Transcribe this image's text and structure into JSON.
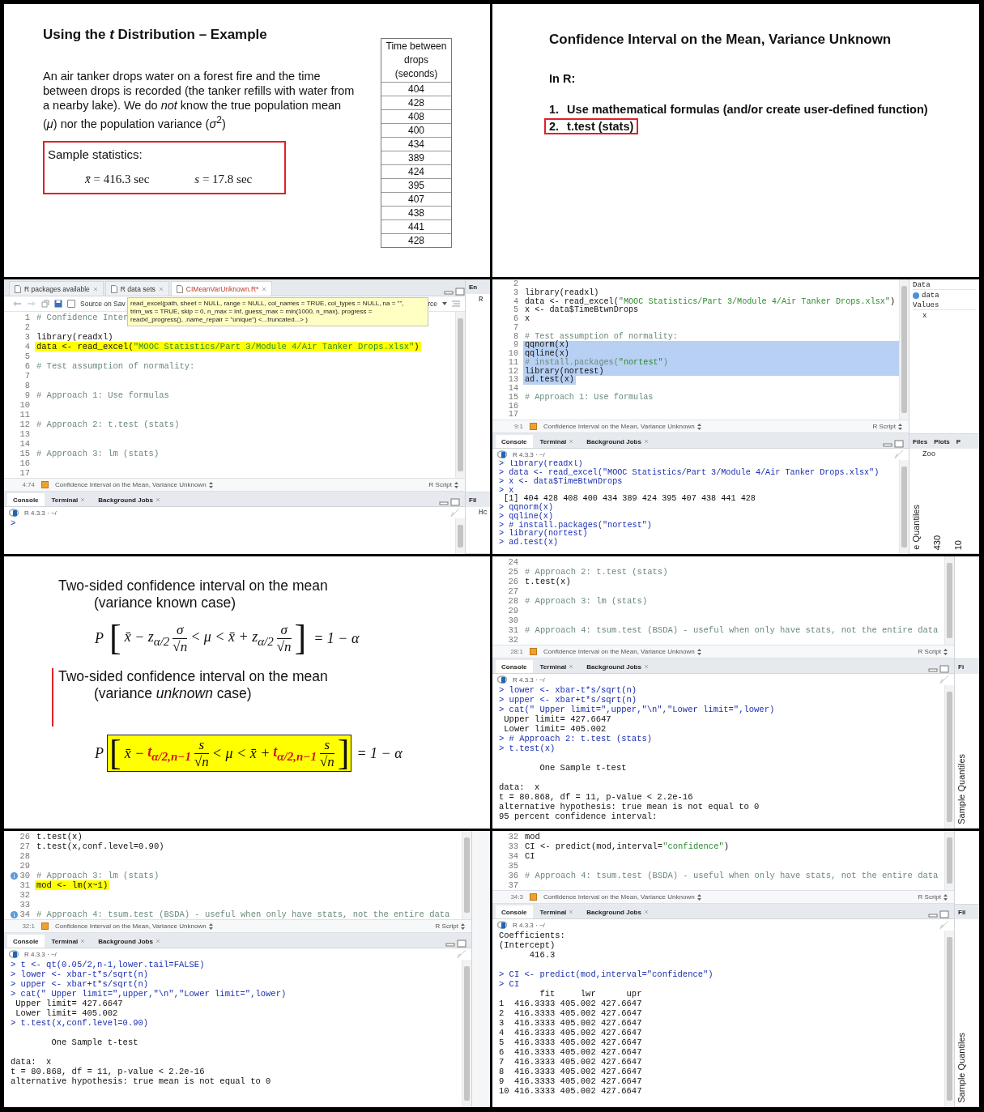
{
  "panels": [
    {
      "kind": "slide_example",
      "title": "Using the *t* Distribution – Example",
      "paragraph": "An air tanker drops water on a forest fire and the time between drops is recorded (the tanker refills with water from a nearby lake).  We do *not* know the true population mean (*μ*) nor the population variance (*σ*$^{2}$)",
      "stats": {
        "label": "Sample statistics:",
        "values": [
          "*x̄* = 416.3 sec",
          "*s* = 17.8 sec"
        ]
      },
      "table": {
        "header": "Time between drops (seconds)",
        "values": [
          "404",
          "428",
          "408",
          "400",
          "434",
          "389",
          "424",
          "395",
          "407",
          "438",
          "441",
          "428"
        ]
      }
    },
    {
      "kind": "slide_list",
      "title": "Confidence Interval on the Mean, Variance Unknown",
      "subtitle": "In R:",
      "items": [
        {
          "number": "1.",
          "text": "Use mathematical formulas (and/or create user-defined function)",
          "boxed": false
        },
        {
          "number": "2.",
          "text": "t.test (stats)",
          "boxed": true
        }
      ]
    },
    {
      "kind": "rstudio",
      "editor_tabs": [
        {
          "label": "R packages available",
          "selected": false
        },
        {
          "label": "R data sets",
          "selected": false
        },
        {
          "label": "CIMeanVarUnknown.R*",
          "selected": true
        }
      ],
      "toolbar": {
        "checkbox": "Source on Sav",
        "checked": false,
        "button": "rce"
      },
      "tooltip": "read_excel(path, sheet = NULL, range = NULL, col_names = TRUE, col_types = NULL, na = \"\", trim_ws = TRUE, skip = 0, n_max = Inf, guess_max = min(1000, n_max), progress = readxl_progress(), .name_repair = \"unique\")  <...truncated...> )",
      "editor": [
        {
          "n": "1",
          "text": "# Confidence Inter",
          "kind": "comment"
        },
        {
          "n": "2"
        },
        {
          "n": "3",
          "text": "library(readxl)",
          "kind": "code"
        },
        {
          "n": "4",
          "text": "data <- read_excel(\"MOOC Statistics/Part 3/Module 4/Air Tanker Drops.xlsx\")",
          "kind": "code",
          "highlighted": true
        },
        {
          "n": "5"
        },
        {
          "n": "6",
          "text": "# Test assumption of normality:",
          "kind": "comment"
        },
        {
          "n": "7"
        },
        {
          "n": "8"
        },
        {
          "n": "9",
          "text": "# Approach 1: Use formulas",
          "kind": "comment"
        },
        {
          "n": "10"
        },
        {
          "n": "11"
        },
        {
          "n": "12",
          "text": "# Approach 2: t.test (stats)",
          "kind": "comment"
        },
        {
          "n": "13"
        },
        {
          "n": "14"
        },
        {
          "n": "15",
          "text": "# Approach 3: lm (stats)",
          "kind": "comment"
        },
        {
          "n": "16"
        },
        {
          "n": "17"
        }
      ],
      "status": {
        "position": "4:74",
        "scope": "Confidence Interval on the Mean, Variance Unknown",
        "type": "R Script"
      },
      "console_tabs": [
        {
          "label": "Console",
          "selected": true,
          "closable": false
        },
        {
          "label": "Terminal",
          "selected": false,
          "closable": true
        },
        {
          "label": "Background Jobs",
          "selected": false,
          "closable": true
        }
      ],
      "console_title": "R 4.3.3 · ~/",
      "console": [
        {
          "kind": "input",
          "text": ">"
        }
      ],
      "side": {
        "kind": "narrow",
        "panes": [
          {
            "tabs": [
              "En"
            ],
            "items": [
              {
                "kind": "value",
                "text": "R"
              }
            ]
          },
          {
            "tabs": [
              "Fil"
            ],
            "items": [
              {
                "kind": "value",
                "text": "Hc"
              }
            ]
          }
        ]
      }
    },
    {
      "kind": "rstudio",
      "editor": [
        {
          "n": "2"
        },
        {
          "n": "3",
          "text": "library(readxl)",
          "kind": "code"
        },
        {
          "n": "4",
          "text": "data <- read_excel(\"MOOC Statistics/Part 3/Module 4/Air Tanker Drops.xlsx\")",
          "kind": "code"
        },
        {
          "n": "5",
          "text": "x <- data$TimeBtwnDrops",
          "kind": "code"
        },
        {
          "n": "6",
          "text": "x",
          "kind": "code"
        },
        {
          "n": "7"
        },
        {
          "n": "8",
          "text": "# Test assumption of normality:",
          "kind": "comment"
        },
        {
          "n": "9",
          "text": "qqnorm(x)",
          "kind": "code",
          "selected": true
        },
        {
          "n": "10",
          "text": "qqline(x)",
          "kind": "code",
          "selected": true
        },
        {
          "n": "11",
          "text": "# install.packages(\"nortest\")",
          "kind": "comment",
          "selected": true
        },
        {
          "n": "12",
          "text": "library(nortest)",
          "kind": "code",
          "selected": true
        },
        {
          "n": "13",
          "text": "ad.test(x)",
          "kind": "code",
          "selected": true
        },
        {
          "n": "14"
        },
        {
          "n": "15",
          "text": "# Approach 1: Use formulas",
          "kind": "comment"
        },
        {
          "n": "16"
        },
        {
          "n": "17"
        }
      ],
      "status": {
        "position": "9:1",
        "scope": "Confidence Interval on the Mean, Variance Unknown",
        "type": "R Script"
      },
      "console_tabs": [
        {
          "label": "Console",
          "selected": true,
          "closable": false
        },
        {
          "label": "Terminal",
          "selected": false,
          "closable": true
        },
        {
          "label": "Background Jobs",
          "selected": false,
          "closable": true
        }
      ],
      "console_title": "R 4.3.3 · ~/",
      "console": [
        {
          "kind": "input",
          "text": "> library(readxl)"
        },
        {
          "kind": "input",
          "text": "> data <- read_excel(\"MOOC Statistics/Part 3/Module 4/Air Tanker Drops.xlsx\")"
        },
        {
          "kind": "input",
          "text": "> x <- data$TimeBtwnDrops"
        },
        {
          "kind": "input",
          "text": "> x"
        },
        {
          "kind": "output",
          "text": " [1] 404 428 408 400 434 389 424 395 407 438 441 428"
        },
        {
          "kind": "input",
          "text": "> qqnorm(x)"
        },
        {
          "kind": "input",
          "text": "> qqline(x)"
        },
        {
          "kind": "input",
          "text": "> # install.packages(\"nortest\")"
        },
        {
          "kind": "input",
          "text": "> library(nortest)"
        },
        {
          "kind": "input",
          "text": "> ad.test(x)"
        }
      ],
      "side": {
        "kind": "wide",
        "panes": [
          {
            "items": [
              {
                "kind": "header",
                "text": "Data"
              },
              {
                "kind": "object",
                "text": "data"
              },
              {
                "kind": "header",
                "text": "Values"
              },
              {
                "kind": "value",
                "text": "x"
              }
            ]
          },
          {
            "tabs": [
              "Files",
              "Plots",
              "P"
            ],
            "items": [
              {
                "kind": "value",
                "text": "Zoo"
              },
              {
                "kind": "vertical",
                "text": "e Quantiles"
              },
              {
                "kind": "vertical",
                "text": "430"
              },
              {
                "kind": "vertical",
                "text": "10"
              }
            ]
          }
        ]
      }
    },
    {
      "kind": "slide_formulas",
      "sections": [
        {
          "heading": "Two-sided confidence interval on the mean",
          "subheading": "(variance known case)",
          "marked": false,
          "formula": {
            "lead": "P",
            "open": "[",
            "close": "]",
            "tail": "= 1 − α",
            "body": [
              {
                "kind": "text",
                "text": "x̄ − z$_{α/2}$"
              },
              {
                "kind": "frac",
                "num": "σ",
                "den": "√n"
              },
              {
                "kind": "text",
                "text": "< μ < x̄ + z$_{α/2}$"
              },
              {
                "kind": "frac",
                "num": "σ",
                "den": "√n"
              }
            ]
          }
        },
        {
          "heading": "Two-sided confidence interval on the mean",
          "subheading": "(variance *unknown* case)",
          "marked": true,
          "formula": {
            "lead": "P",
            "open": "[",
            "close": "]",
            "tail": "= 1 − α",
            "body": [
              {
                "kind": "text",
                "text": "x̄ −"
              },
              {
                "kind": "accent",
                "text": "t$_{α/2,n−1}$"
              },
              {
                "kind": "frac",
                "num": "s",
                "den": "√n"
              },
              {
                "kind": "text",
                "text": "< μ < x̄ +"
              },
              {
                "kind": "accent",
                "text": "t$_{α/2,n−1}$"
              },
              {
                "kind": "frac",
                "num": "s",
                "den": "√n"
              }
            ]
          }
        }
      ]
    },
    {
      "kind": "rstudio",
      "editor": [
        {
          "n": "24"
        },
        {
          "n": "25",
          "text": "# Approach 2: t.test (stats)",
          "kind": "comment"
        },
        {
          "n": "26",
          "text": "t.test(x)",
          "kind": "code"
        },
        {
          "n": "27"
        },
        {
          "n": "28",
          "text": "# Approach 3: lm (stats)",
          "kind": "comment"
        },
        {
          "n": "29"
        },
        {
          "n": "30"
        },
        {
          "n": "31",
          "text": "# Approach 4: tsum.test (BSDA) - useful when only have stats, not the entire data",
          "kind": "comment"
        },
        {
          "n": "32"
        }
      ],
      "status": {
        "position": "28:1",
        "scope": "Confidence Interval on the Mean, Variance Unknown",
        "type": "R Script"
      },
      "console_tabs": [
        {
          "label": "Console",
          "selected": true,
          "closable": false
        },
        {
          "label": "Terminal",
          "selected": false,
          "closable": true
        },
        {
          "label": "Background Jobs",
          "selected": false,
          "closable": true
        }
      ],
      "console_title": "R 4.3.3 · ~/",
      "console": [
        {
          "kind": "input",
          "text": "> lower <- xbar-t*s/sqrt(n)"
        },
        {
          "kind": "input",
          "text": "> upper <- xbar+t*s/sqrt(n)"
        },
        {
          "kind": "input",
          "text": "> cat(\" Upper limit=\",upper,\"\\n\",\"Lower limit=\",lower)"
        },
        {
          "kind": "output",
          "text": " Upper limit= 427.6647"
        },
        {
          "kind": "output",
          "text": " Lower limit= 405.002"
        },
        {
          "kind": "input",
          "text": "> # Approach 2: t.test (stats)"
        },
        {
          "kind": "input",
          "text": "> t.test(x)"
        },
        {
          "kind": "blank"
        },
        {
          "kind": "output",
          "text": "        One Sample t-test"
        },
        {
          "kind": "blank"
        },
        {
          "kind": "output",
          "text": "data:  x"
        },
        {
          "kind": "output",
          "text": "t = 80.868, df = 11, p-value < 2.2e-16"
        },
        {
          "kind": "output",
          "text": "alternative hypothesis: true mean is not equal to 0"
        },
        {
          "kind": "output",
          "text": "95 percent confidence interval:"
        }
      ],
      "side": {
        "kind": "narrow",
        "panes": [
          {
            "tabs": [
              "Fi"
            ],
            "items": [
              {
                "kind": "vertical",
                "text": "Sample Quantiles"
              }
            ]
          }
        ]
      }
    },
    {
      "kind": "rstudio",
      "editor": [
        {
          "n": "26",
          "text": "t.test(x)",
          "kind": "code",
          "info": false
        },
        {
          "n": "27",
          "text": "t.test(x,conf.level=0.90)",
          "kind": "code",
          "info": false
        },
        {
          "n": "28",
          "info": false
        },
        {
          "n": "29",
          "info": false
        },
        {
          "n": "30",
          "text": "# Approach 3: lm (stats)",
          "kind": "comment",
          "info": true
        },
        {
          "n": "31",
          "text": "mod <- lm(x~1)",
          "kind": "code",
          "highlighted": true,
          "info": false
        },
        {
          "n": "32",
          "info": false
        },
        {
          "n": "33",
          "info": false
        },
        {
          "n": "34",
          "text": "# Approach 4: tsum.test (BSDA) - useful when only have stats, not the entire data",
          "kind": "comment",
          "info": true
        }
      ],
      "status": {
        "position": "32:1",
        "scope": "Confidence Interval on the Mean, Variance Unknown",
        "type": "R Script"
      },
      "console_tabs": [
        {
          "label": "Console",
          "selected": true,
          "closable": false
        },
        {
          "label": "Terminal",
          "selected": false,
          "closable": true
        },
        {
          "label": "Background Jobs",
          "selected": false,
          "closable": true
        }
      ],
      "console_title": "R 4.3.3 · ~/",
      "console": [
        {
          "kind": "input",
          "text": "> t <- qt(0.05/2,n-1,lower.tail=FALSE)"
        },
        {
          "kind": "input",
          "text": "> lower <- xbar-t*s/sqrt(n)"
        },
        {
          "kind": "input",
          "text": "> upper <- xbar+t*s/sqrt(n)"
        },
        {
          "kind": "input",
          "text": "> cat(\" Upper limit=\",upper,\"\\n\",\"Lower limit=\",lower)"
        },
        {
          "kind": "output",
          "text": " Upper limit= 427.6647"
        },
        {
          "kind": "output",
          "text": " Lower limit= 405.002"
        },
        {
          "kind": "input",
          "text": "> t.test(x,conf.level=0.90)"
        },
        {
          "kind": "blank"
        },
        {
          "kind": "output",
          "text": "        One Sample t-test"
        },
        {
          "kind": "blank"
        },
        {
          "kind": "output",
          "text": "data:  x"
        },
        {
          "kind": "output",
          "text": "t = 80.868, df = 11, p-value < 2.2e-16"
        },
        {
          "kind": "output",
          "text": "alternative hypothesis: true mean is not equal to 0"
        }
      ],
      "side": {
        "kind": "thin"
      }
    },
    {
      "kind": "rstudio",
      "editor": [
        {
          "n": "32",
          "text": "mod",
          "kind": "code"
        },
        {
          "n": "33",
          "text": "CI <- predict(mod,interval=\"confidence\")",
          "kind": "code"
        },
        {
          "n": "34",
          "text": "CI",
          "kind": "code"
        },
        {
          "n": "35"
        },
        {
          "n": "36",
          "text": "# Approach 4: tsum.test (BSDA) - useful when only have stats, not the entire data",
          "kind": "comment"
        },
        {
          "n": "37"
        }
      ],
      "status": {
        "position": "34:3",
        "scope": "Confidence Interval on the Mean, Variance Unknown",
        "type": "R Script"
      },
      "console_tabs": [
        {
          "label": "Console",
          "selected": true,
          "closable": false
        },
        {
          "label": "Terminal",
          "selected": false,
          "closable": true
        },
        {
          "label": "Background Jobs",
          "selected": false,
          "closable": true
        }
      ],
      "console_title": "R 4.3.3 · ~/",
      "console": [
        {
          "kind": "output",
          "text": "Coefficients:"
        },
        {
          "kind": "output",
          "text": "(Intercept)"
        },
        {
          "kind": "output",
          "text": "      416.3"
        },
        {
          "kind": "blank"
        },
        {
          "kind": "input",
          "text": "> CI <- predict(mod,interval=\"confidence\")"
        },
        {
          "kind": "input",
          "text": "> CI"
        },
        {
          "kind": "output",
          "text": "        fit     lwr      upr"
        },
        {
          "kind": "output",
          "text": "1  416.3333 405.002 427.6647"
        },
        {
          "kind": "output",
          "text": "2  416.3333 405.002 427.6647"
        },
        {
          "kind": "output",
          "text": "3  416.3333 405.002 427.6647"
        },
        {
          "kind": "output",
          "text": "4  416.3333 405.002 427.6647"
        },
        {
          "kind": "output",
          "text": "5  416.3333 405.002 427.6647"
        },
        {
          "kind": "output",
          "text": "6  416.3333 405.002 427.6647"
        },
        {
          "kind": "output",
          "text": "7  416.3333 405.002 427.6647"
        },
        {
          "kind": "output",
          "text": "8  416.3333 405.002 427.6647"
        },
        {
          "kind": "output",
          "text": "9  416.3333 405.002 427.6647"
        },
        {
          "kind": "output",
          "text": "10 416.3333 405.002 427.6647"
        }
      ],
      "side": {
        "kind": "narrow",
        "panes": [
          {
            "tabs": [
              "Fil"
            ],
            "items": [
              {
                "kind": "vertical",
                "text": "Sample Quantiles"
              }
            ]
          }
        ]
      }
    }
  ]
}
